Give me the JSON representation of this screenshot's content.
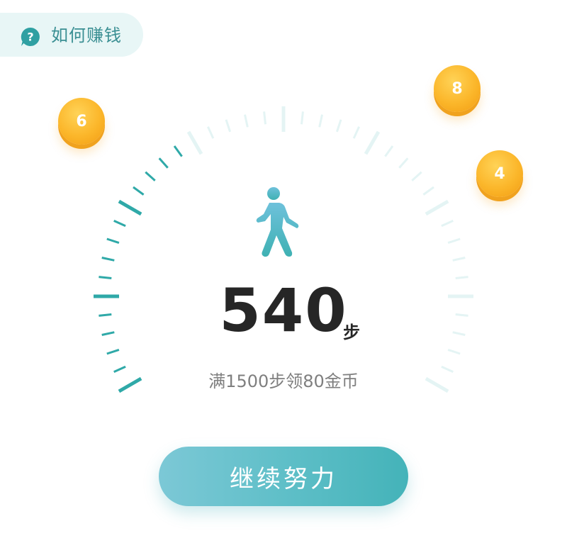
{
  "help": {
    "label": "如何赚钱",
    "icon": "question-bubble-icon"
  },
  "steps": {
    "value": "540",
    "unit": "步",
    "goal_text": "满1500步领80金币",
    "progress": 0.36
  },
  "coins": [
    {
      "value": "6"
    },
    {
      "value": "8"
    },
    {
      "value": "4"
    }
  ],
  "walker_icon": "walking-person-icon",
  "action": {
    "continue_label": "继续努力"
  },
  "colors": {
    "accent": "#2fa9a8",
    "tick_inactive": "#e4f4f4",
    "coin": "#fbb62a",
    "button": "#5fbfc8",
    "text_dark": "#262626",
    "text_muted": "#7f7f7f"
  }
}
